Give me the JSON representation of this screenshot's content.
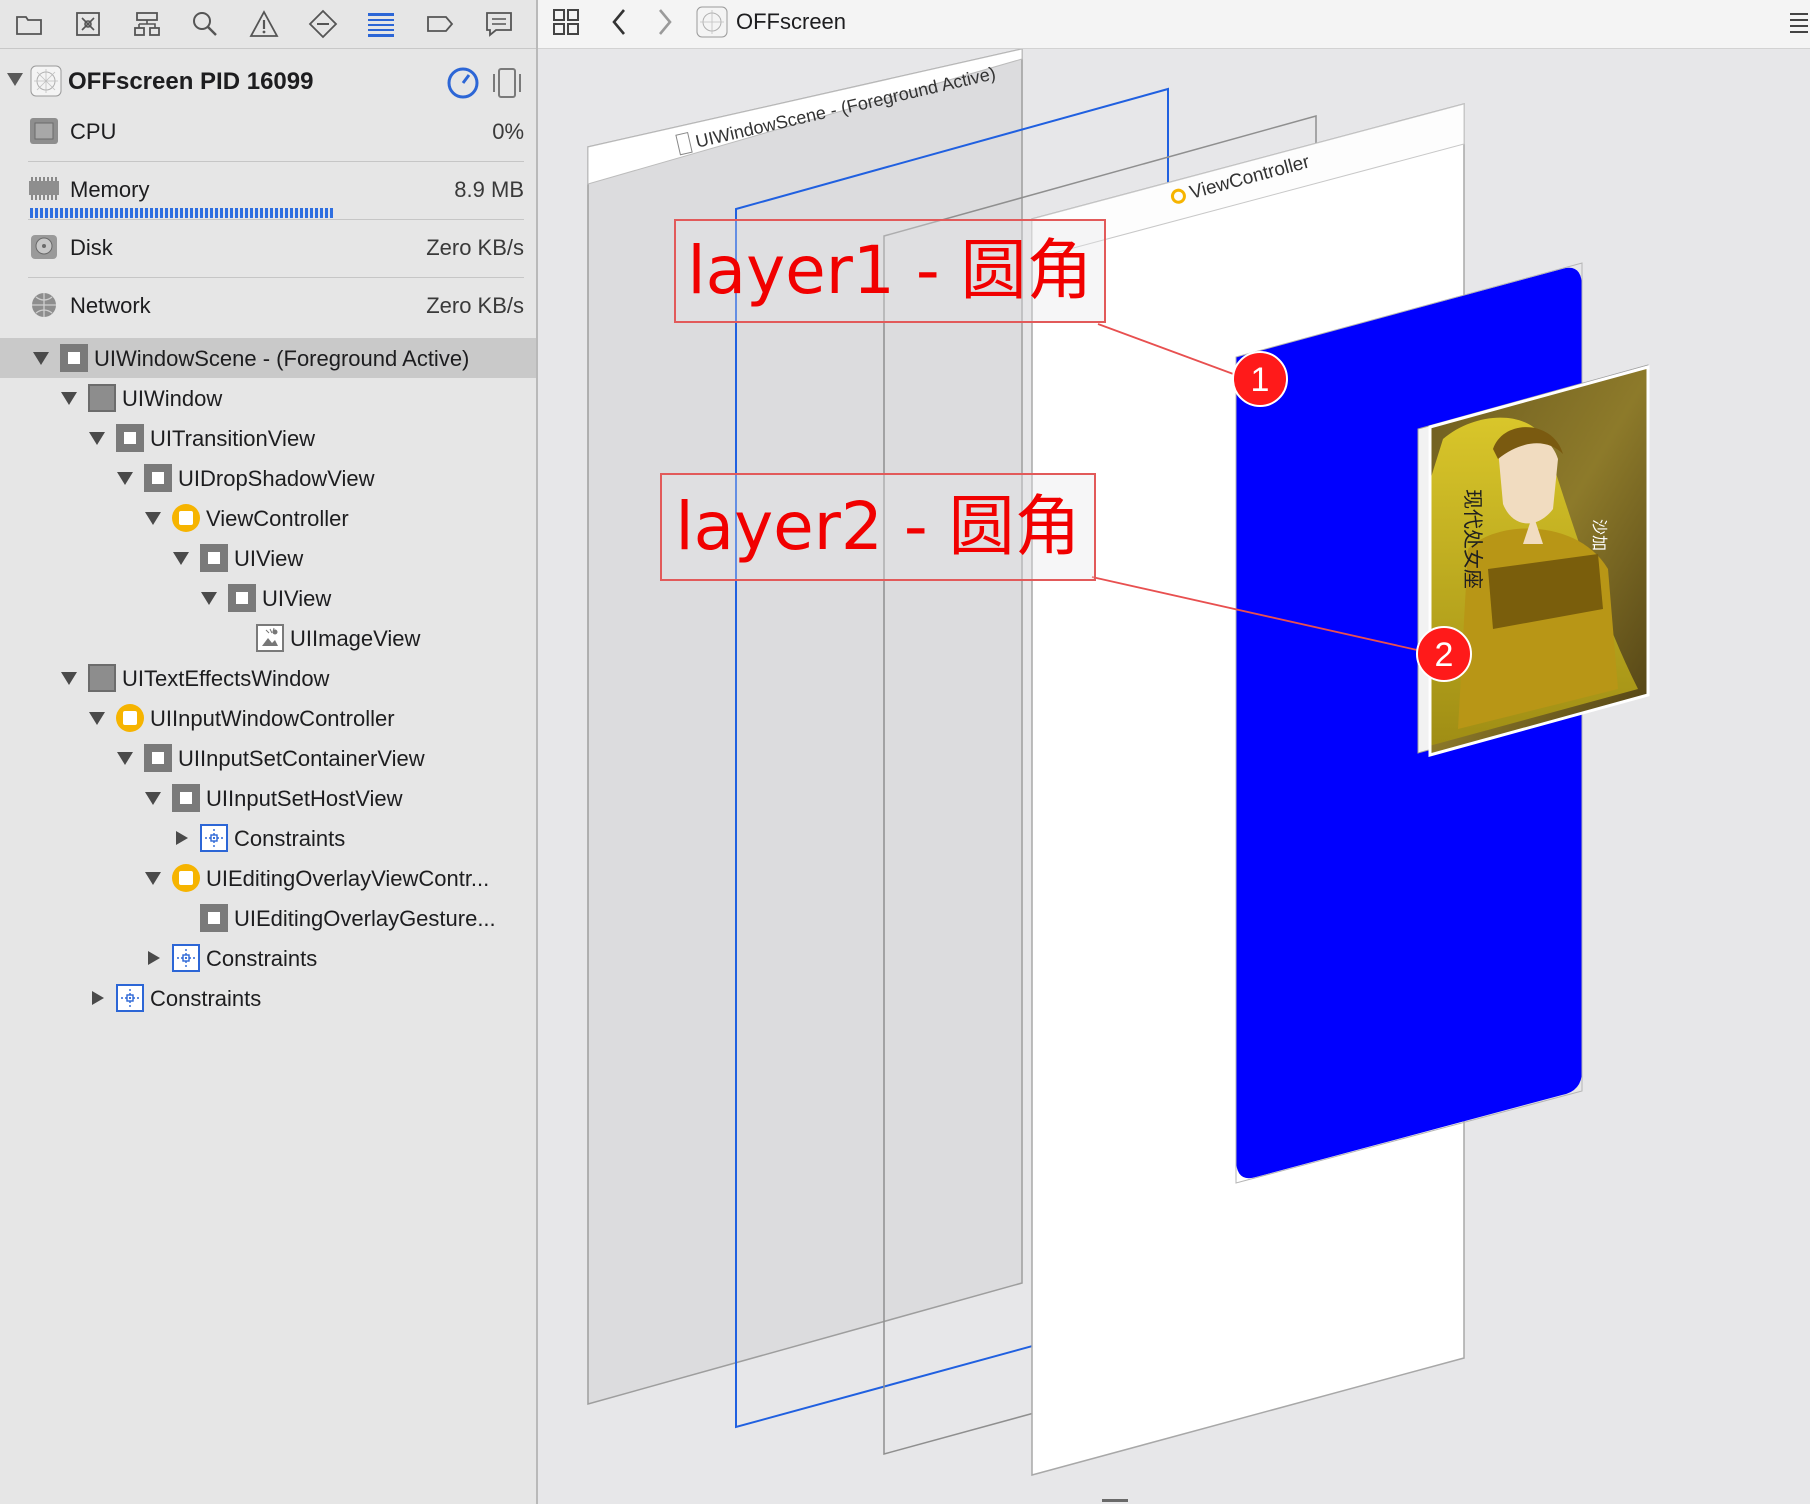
{
  "process": {
    "title": "OFFscreen PID 16099",
    "metrics": [
      {
        "label": "CPU",
        "value": "0%",
        "icon": "cpu-icon"
      },
      {
        "label": "Memory",
        "value": "8.9 MB",
        "icon": "memory-icon"
      },
      {
        "label": "Disk",
        "value": "Zero KB/s",
        "icon": "disk-icon"
      },
      {
        "label": "Network",
        "value": "Zero KB/s",
        "icon": "network-icon"
      }
    ]
  },
  "tree": [
    {
      "label": "UIWindowScene - (Foreground Active)",
      "level": 0,
      "icon": "view",
      "expanded": true,
      "selected": true
    },
    {
      "label": "UIWindow",
      "level": 1,
      "icon": "window",
      "expanded": true
    },
    {
      "label": "UITransitionView",
      "level": 2,
      "icon": "view",
      "expanded": true
    },
    {
      "label": "UIDropShadowView",
      "level": 3,
      "icon": "view",
      "expanded": true
    },
    {
      "label": "ViewController",
      "level": 4,
      "icon": "viewcontroller",
      "expanded": true
    },
    {
      "label": "UIView",
      "level": 5,
      "icon": "view",
      "expanded": true
    },
    {
      "label": "UIView",
      "level": 6,
      "icon": "view",
      "expanded": true
    },
    {
      "label": "UIImageView",
      "level": 7,
      "icon": "imageview",
      "expanded": null
    },
    {
      "label": "UITextEffectsWindow",
      "level": 1,
      "icon": "window",
      "expanded": true
    },
    {
      "label": "UIInputWindowController",
      "level": 2,
      "icon": "viewcontroller",
      "expanded": true
    },
    {
      "label": "UIInputSetContainerView",
      "level": 3,
      "icon": "view",
      "expanded": true
    },
    {
      "label": "UIInputSetHostView",
      "level": 4,
      "icon": "view",
      "expanded": true
    },
    {
      "label": "Constraints",
      "level": 5,
      "icon": "constraints",
      "expanded": false
    },
    {
      "label": "UIEditingOverlayViewContr...",
      "level": 4,
      "icon": "viewcontroller",
      "expanded": true
    },
    {
      "label": "UIEditingOverlayGesture...",
      "level": 5,
      "icon": "view",
      "expanded": null
    },
    {
      "label": "Constraints",
      "level": 4,
      "icon": "constraints",
      "expanded": false
    },
    {
      "label": "Constraints",
      "level": 2,
      "icon": "constraints",
      "expanded": false
    }
  ],
  "jump_bar": {
    "title": "OFFscreen"
  },
  "canvas": {
    "scene_label": "UIWindowScene - (Foreground Active)",
    "vc_label": "ViewController",
    "annotations": [
      {
        "label": "layer1 - 圆角",
        "marker": "1"
      },
      {
        "label": "layer2 - 圆角",
        "marker": "2"
      }
    ],
    "image_caption": "现代处女座",
    "image_name": "沙加"
  },
  "colors": {
    "accent": "#2c66d6",
    "annotation": "#f10000",
    "blue_layer": "#0000ff",
    "vc_icon": "#f6b400"
  }
}
